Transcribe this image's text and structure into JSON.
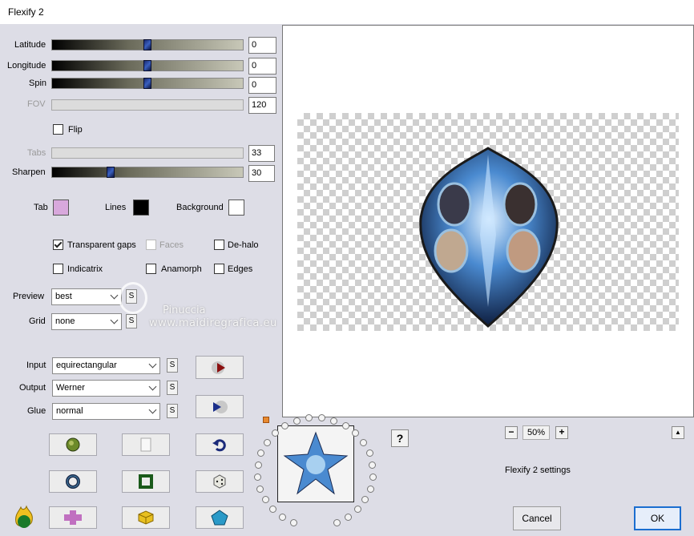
{
  "window": {
    "title": "Flexify 2"
  },
  "sliders": [
    {
      "id": "latitude",
      "label": "Latitude",
      "value": "0",
      "position": 0.5,
      "enabled": true
    },
    {
      "id": "longitude",
      "label": "Longitude",
      "value": "0",
      "position": 0.5,
      "enabled": true
    },
    {
      "id": "spin",
      "label": "Spin",
      "value": "0",
      "position": 0.5,
      "enabled": true
    },
    {
      "id": "fov",
      "label": "FOV",
      "value": "120",
      "enabled": false
    },
    {
      "id": "tabs",
      "label": "Tabs",
      "value": "33",
      "enabled": false
    },
    {
      "id": "sharpen",
      "label": "Sharpen",
      "value": "30",
      "position": 0.3,
      "enabled": true
    }
  ],
  "flip": {
    "label": "Flip",
    "checked": false
  },
  "colors": {
    "tab": {
      "label": "Tab",
      "color": "#d8a8dc"
    },
    "lines": {
      "label": "Lines",
      "color": "#000000"
    },
    "background": {
      "label": "Background",
      "color": "#ffffff"
    }
  },
  "checkboxes": {
    "transparent_gaps": {
      "label": "Transparent gaps",
      "checked": true
    },
    "faces": {
      "label": "Faces",
      "checked": false,
      "enabled": false
    },
    "de_halo": {
      "label": "De-halo",
      "checked": false
    },
    "indicatrix": {
      "label": "Indicatrix",
      "checked": false
    },
    "anamorph": {
      "label": "Anamorph",
      "checked": false
    },
    "edges": {
      "label": "Edges",
      "checked": false
    }
  },
  "preview": {
    "label": "Preview",
    "value": "best"
  },
  "grid": {
    "label": "Grid",
    "value": "none"
  },
  "input": {
    "label": "Input",
    "value": "equirectangular"
  },
  "output": {
    "label": "Output",
    "value": "Werner"
  },
  "glue": {
    "label": "Glue",
    "value": "normal"
  },
  "s_label": "S",
  "watermark": {
    "line1": "Pinuccia",
    "line2": "www.maidiregrafica.eu"
  },
  "zoom": {
    "value": "50%",
    "minus": "−",
    "plus": "+"
  },
  "help": "?",
  "scroll_up": "▲",
  "settings_label": "Flexify 2 settings",
  "buttons": {
    "cancel": "Cancel",
    "ok": "OK"
  },
  "accent": "#1b6ed0"
}
